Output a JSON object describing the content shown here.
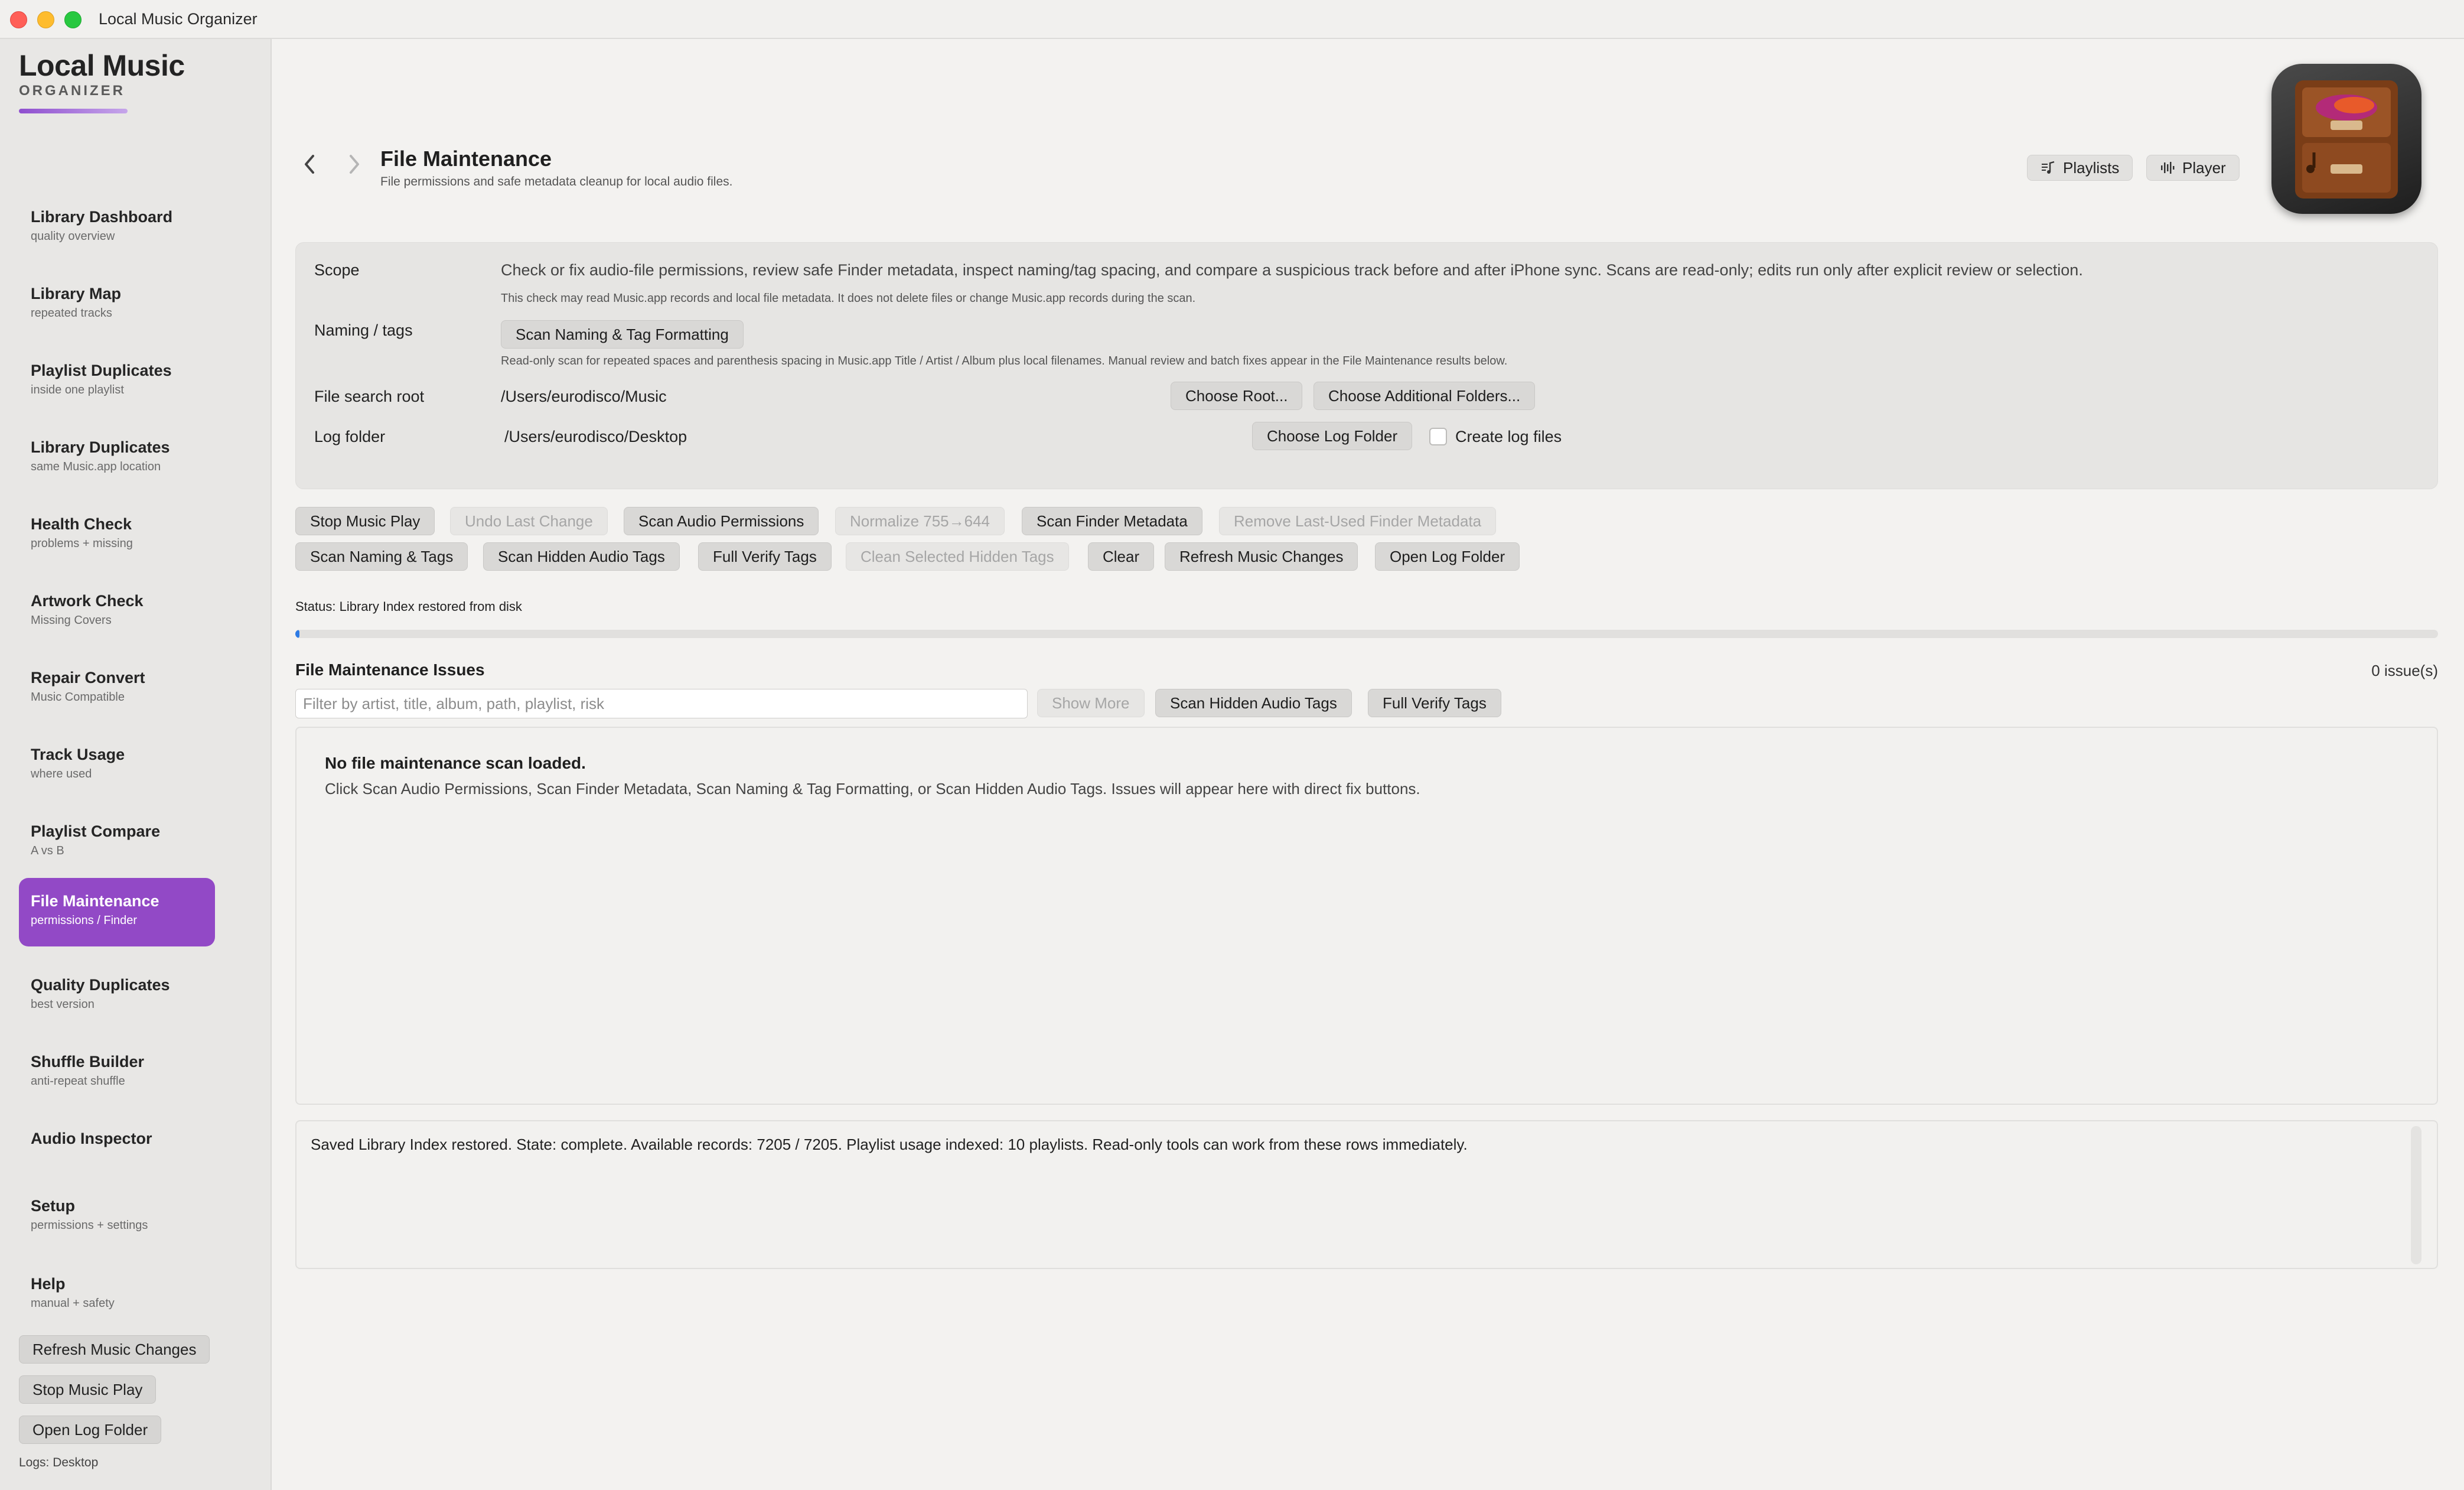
{
  "window": {
    "title": "Local Music Organizer"
  },
  "brand": {
    "title": "Local Music",
    "subtitle": "ORGANIZER"
  },
  "sidebar": {
    "items": [
      {
        "label": "Library Dashboard",
        "sub": "quality overview"
      },
      {
        "label": "Library Map",
        "sub": "repeated tracks"
      },
      {
        "label": "Playlist Duplicates",
        "sub": "inside one playlist"
      },
      {
        "label": "Library Duplicates",
        "sub": "same Music.app location"
      },
      {
        "label": "Health Check",
        "sub": "problems + missing"
      },
      {
        "label": "Artwork Check",
        "sub": "Missing Covers"
      },
      {
        "label": "Repair Convert",
        "sub": "Music Compatible"
      },
      {
        "label": "Track Usage",
        "sub": "where used"
      },
      {
        "label": "Playlist Compare",
        "sub": "A vs B"
      },
      {
        "label": "File Maintenance",
        "sub": "permissions / Finder"
      },
      {
        "label": "Quality Duplicates",
        "sub": "best version"
      },
      {
        "label": "Shuffle Builder",
        "sub": "anti-repeat shuffle"
      },
      {
        "label": "Audio Inspector",
        "sub": ""
      },
      {
        "label": "Setup",
        "sub": "permissions + settings"
      },
      {
        "label": "Help",
        "sub": "manual + safety"
      }
    ],
    "active_index": 9,
    "buttons": {
      "refresh": "Refresh Music Changes",
      "stop": "Stop Music Play",
      "open_log": "Open Log Folder"
    },
    "logs_note": "Logs: Desktop"
  },
  "header": {
    "title": "File Maintenance",
    "subtitle": "File permissions and safe metadata cleanup for local audio files.",
    "back_icon": "chevron-left-icon",
    "forward_icon": "chevron-right-icon",
    "playlists_label": "Playlists",
    "player_label": "Player"
  },
  "scope": {
    "scope_label": "Scope",
    "scope_text": "Check or fix audio-file permissions, review safe Finder metadata, inspect naming/tag spacing, and compare a suspicious track before and after iPhone sync. Scans are read-only; edits run only after explicit review or selection.",
    "scope_note": "This check may read Music.app records and local file metadata. It does not delete files or change Music.app records during the scan.",
    "naming_label": "Naming / tags",
    "naming_button": "Scan Naming & Tag Formatting",
    "naming_note": "Read-only scan for repeated spaces and parenthesis spacing in Music.app Title / Artist / Album plus local filenames. Manual review and batch fixes appear in the File Maintenance results below.",
    "root_label": "File search root",
    "root_value": "/Users/eurodisco/Music",
    "choose_root": "Choose Root...",
    "choose_additional": "Choose Additional Folders...",
    "log_label": "Log folder",
    "log_value": "/Users/eurodisco/Desktop",
    "choose_log": "Choose Log Folder",
    "create_logs": "Create log files"
  },
  "toolbar": {
    "stop_music": "Stop Music Play",
    "undo": "Undo Last Change",
    "scan_permissions": "Scan Audio Permissions",
    "normalize": "Normalize 755→644",
    "scan_finder": "Scan Finder Metadata",
    "remove_finder": "Remove Last-Used Finder Metadata",
    "scan_naming": "Scan Naming & Tags",
    "scan_hidden": "Scan Hidden Audio Tags",
    "full_verify": "Full Verify Tags",
    "clean_hidden": "Clean Selected Hidden Tags",
    "clear": "Clear",
    "refresh": "Refresh Music Changes",
    "open_log": "Open Log Folder"
  },
  "status": {
    "text": "Status: Library Index restored from disk",
    "progress": 0.002
  },
  "issues": {
    "title": "File Maintenance Issues",
    "count": "0 issue(s)",
    "filter_placeholder": "Filter by artist, title, album, path, playlist, risk",
    "show_more": "Show More",
    "scan_hidden": "Scan Hidden Audio Tags",
    "full_verify": "Full Verify Tags",
    "empty_title": "No file maintenance scan loaded.",
    "empty_text": "Click Scan Audio Permissions, Scan Finder Metadata, Scan Naming & Tag Formatting, or Scan Hidden Audio Tags. Issues will appear here with direct fix buttons."
  },
  "log": {
    "text": "Saved Library Index restored. State: complete. Available records: 7205 / 7205. Playlist usage indexed: 10 playlists. Read-only tools can work from these rows immediately."
  }
}
